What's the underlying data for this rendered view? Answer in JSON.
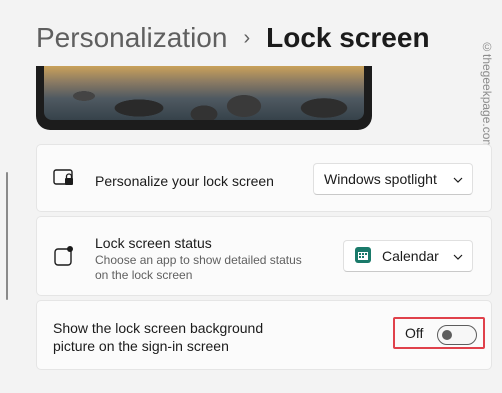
{
  "header": {
    "parent": "Personalization",
    "separator": "›",
    "current": "Lock screen"
  },
  "watermark": "©thegeekpage.com",
  "settings": {
    "personalize": {
      "title": "Personalize your lock screen",
      "icon": "lock-screen-icon",
      "value": "Windows spotlight"
    },
    "status": {
      "title": "Lock screen status",
      "description": "Choose an app to show detailed status on the lock screen",
      "icon": "status-icon",
      "value": "Calendar",
      "value_icon": "calendar-icon"
    },
    "background": {
      "title": "Show the lock screen background picture on the sign-in screen",
      "state_label": "Off",
      "enabled": false
    }
  },
  "colors": {
    "highlight": "#e0414b",
    "calendar_icon": "#1a7a6a"
  }
}
